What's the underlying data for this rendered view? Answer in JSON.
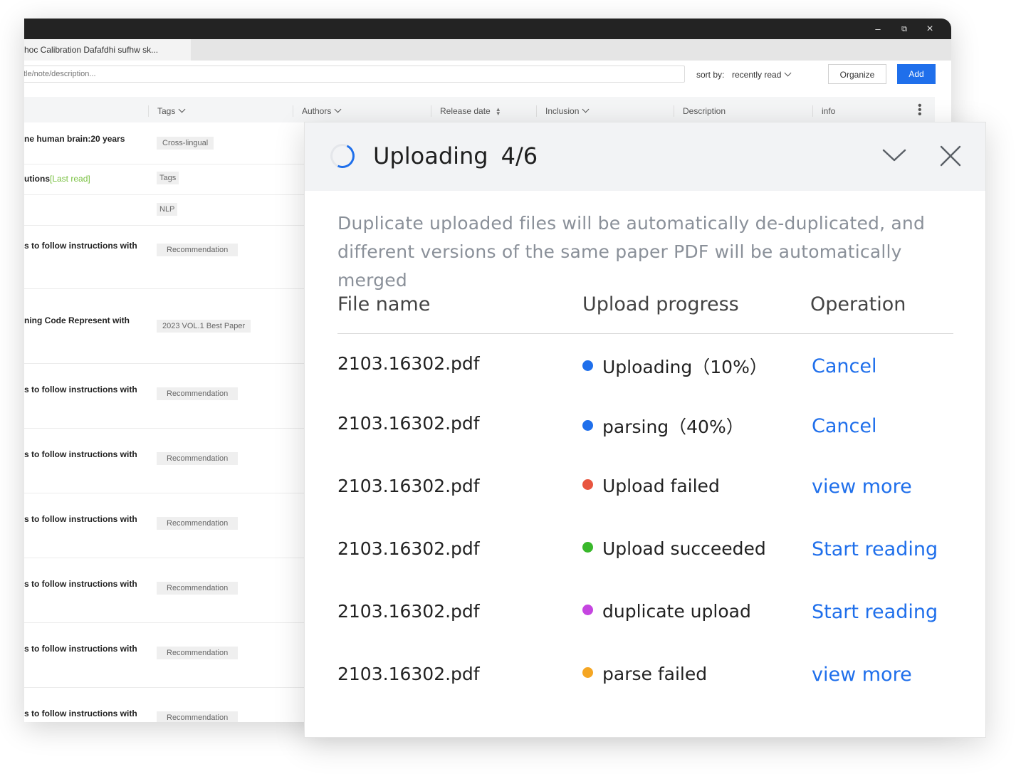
{
  "window": {
    "tab_title": "hoc Calibration Dafafdhi sufhw sk...",
    "controls": {
      "minimize": "–",
      "restore": "⧉",
      "close": "×"
    }
  },
  "toolbar": {
    "search_placeholder": "tle/note/description...",
    "sort_label": "sort by:",
    "sort_value": "recently read",
    "organize_label": "Organize",
    "add_label": "Add"
  },
  "table": {
    "headers": [
      "Tags",
      "Authors",
      "Release date",
      "Inclusion",
      "Description",
      "info"
    ],
    "rows": [
      {
        "title": "ne human brain:20 years",
        "tag": "Cross-lingual"
      },
      {
        "title": "utions",
        "last_read": "[Last read]",
        "tag": "Tags"
      },
      {
        "title": "",
        "tag": "NLP"
      },
      {
        "title": "s to follow instructions with",
        "tag": "Recommendation"
      },
      {
        "title": "ning Code Represent with",
        "tag": "2023 VOL.1 Best Paper"
      },
      {
        "title": "s to follow instructions with",
        "tag": "Recommendation"
      },
      {
        "title": "s to follow instructions with",
        "tag": "Recommendation"
      },
      {
        "title": "s to follow instructions with",
        "tag": "Recommendation"
      },
      {
        "title": "s to follow instructions with",
        "tag": "Recommendation"
      },
      {
        "title": "s to follow instructions with",
        "tag": "Recommendation"
      },
      {
        "title": "s to follow instructions with",
        "tag": "Recommendation"
      }
    ]
  },
  "dialog": {
    "title": "Uploading",
    "count": "4/6",
    "notice": "Duplicate uploaded files will be automatically de-duplicated, and different versions of the same paper PDF will be automatically merged",
    "columns": {
      "file": "File name",
      "progress": "Upload progress",
      "operation": "Operation"
    },
    "files": [
      {
        "name": "2103.16302.pdf",
        "status": "Uploading（10%）",
        "color": "#1f6feb",
        "action": "Cancel"
      },
      {
        "name": "2103.16302.pdf",
        "status": "parsing（40%）",
        "color": "#1f6feb",
        "action": "Cancel"
      },
      {
        "name": "2103.16302.pdf",
        "status": "Upload failed",
        "color": "#e8553f",
        "action": "view more"
      },
      {
        "name": "2103.16302.pdf",
        "status": "Upload succeeded",
        "color": "#39b82b",
        "action": "Start reading"
      },
      {
        "name": "2103.16302.pdf",
        "status": "duplicate upload",
        "color": "#c545e0",
        "action": "Start reading"
      },
      {
        "name": "2103.16302.pdf",
        "status": "parse failed",
        "color": "#f5a623",
        "action": "view more"
      }
    ]
  },
  "colors": {
    "accent": "#1f6feb",
    "last_read": "#7ac142",
    "titlebar": "#232323"
  }
}
